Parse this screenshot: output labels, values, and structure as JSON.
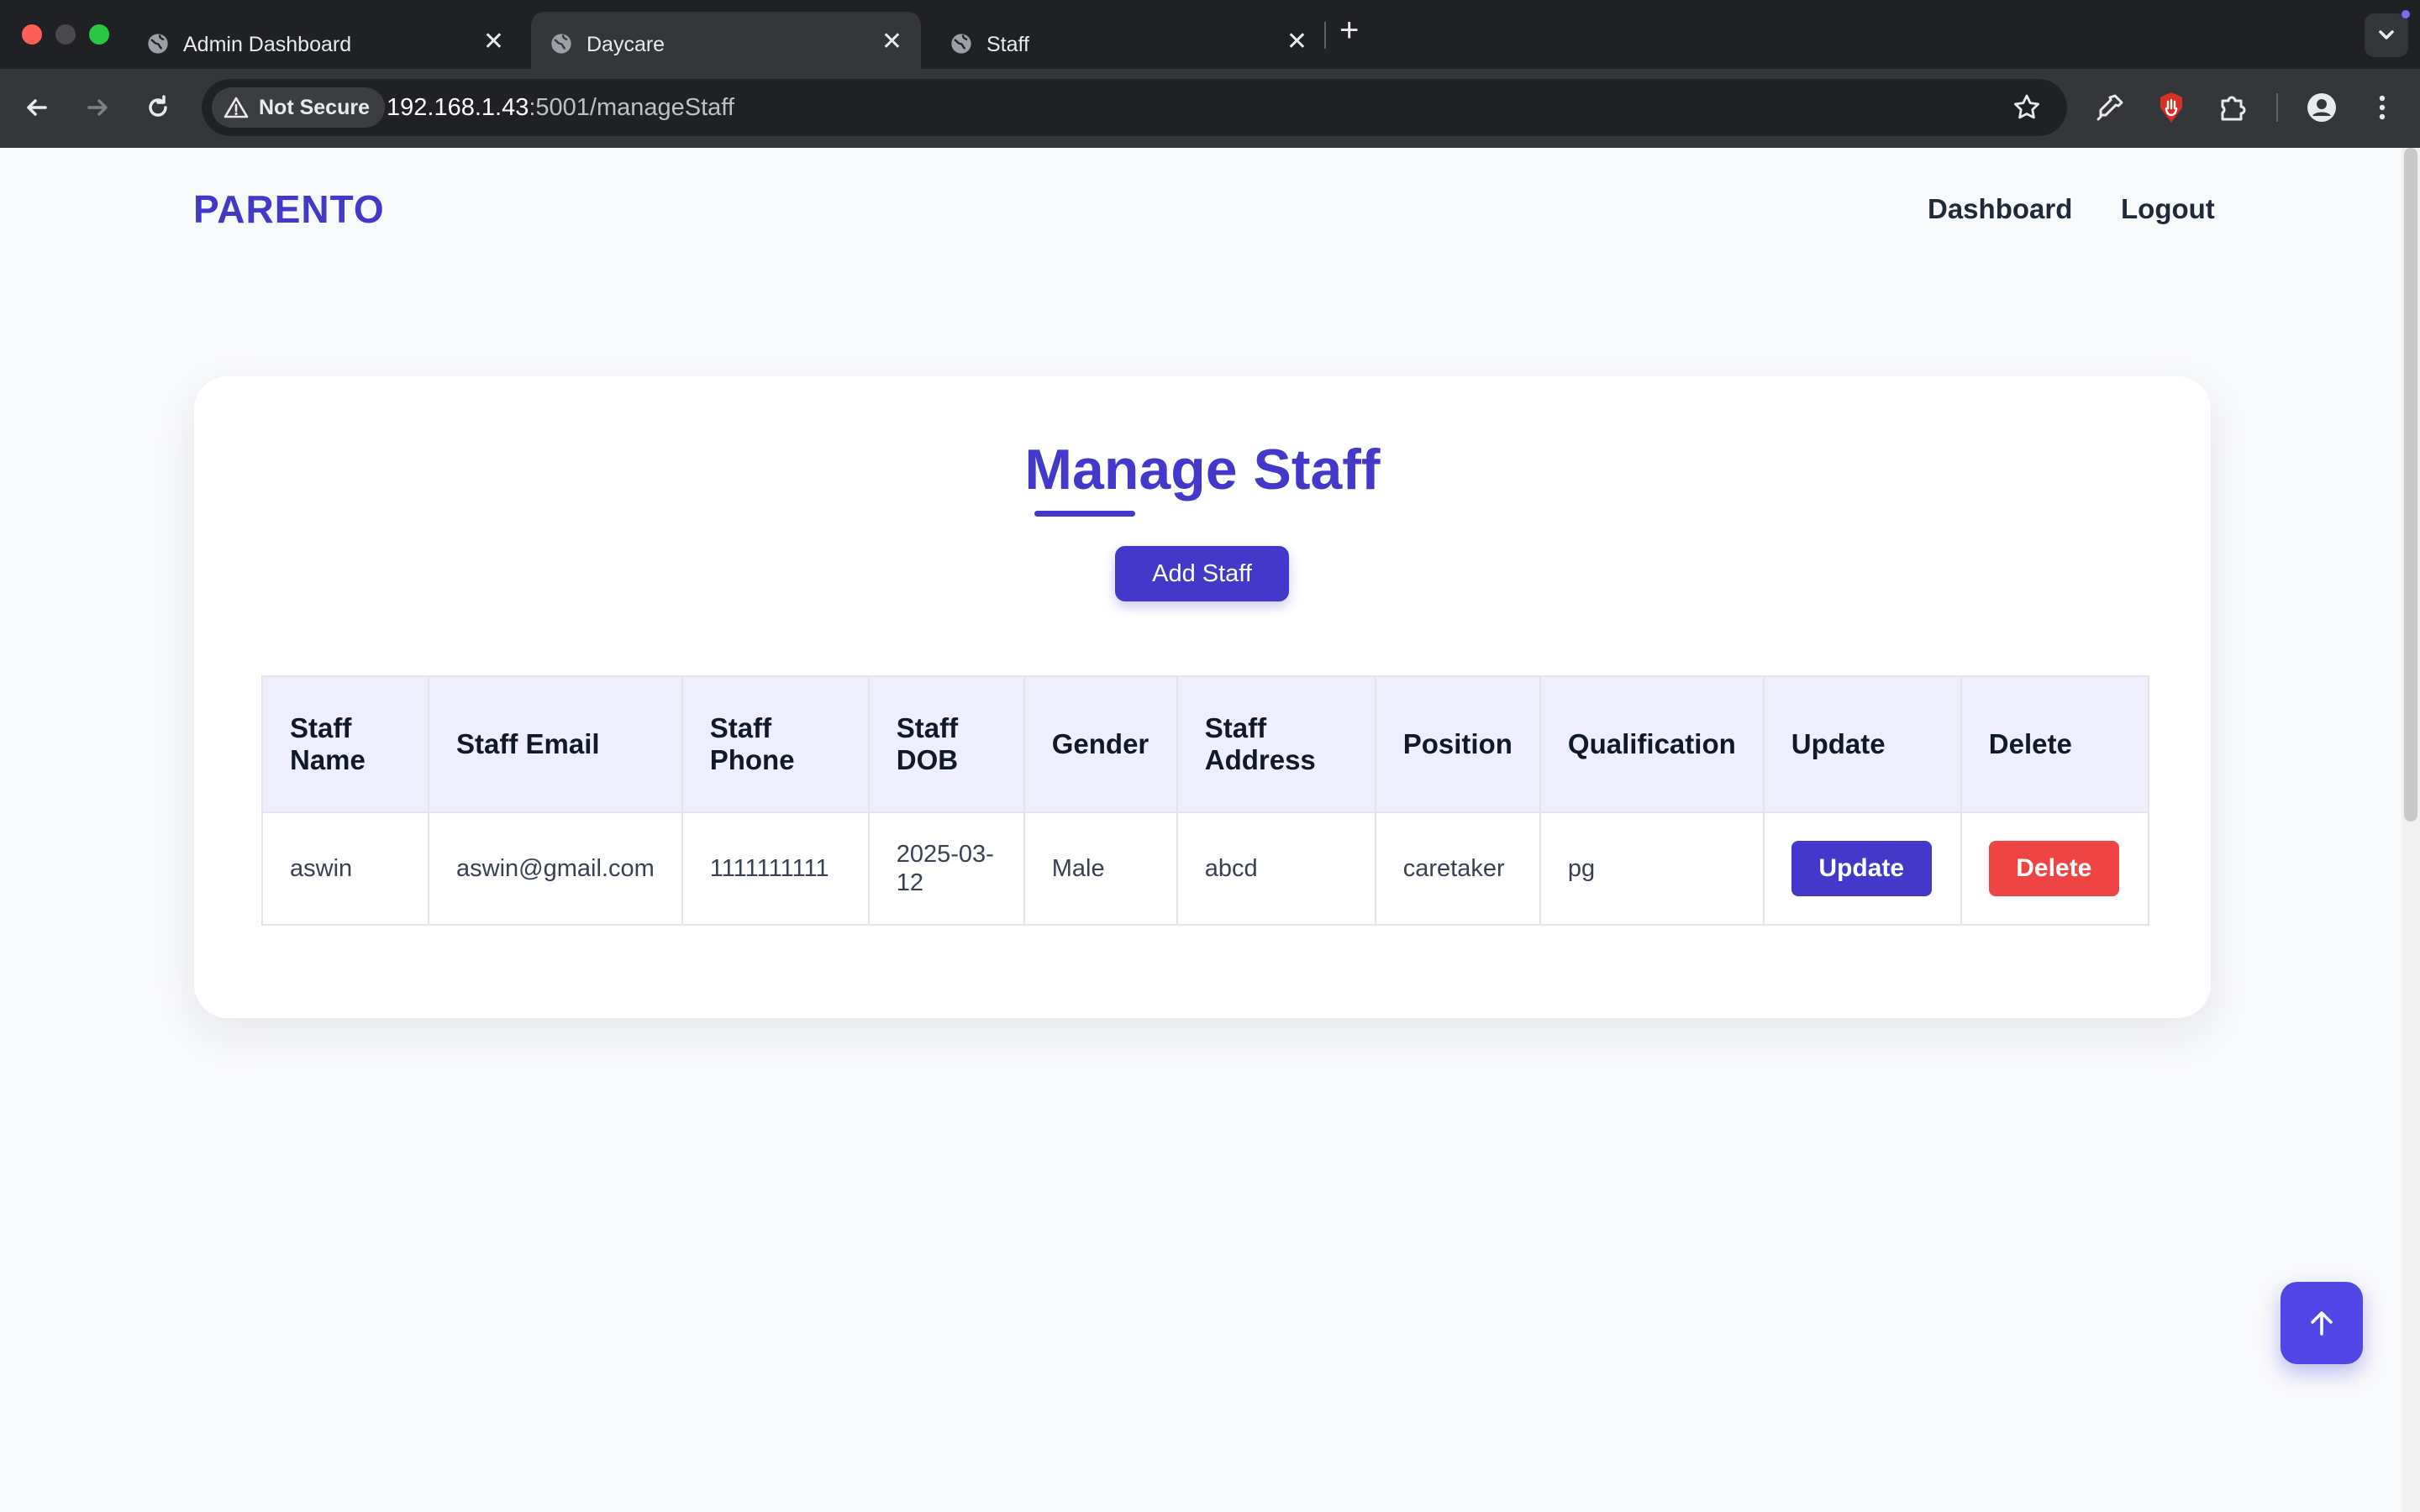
{
  "browser": {
    "tabs": [
      {
        "title": "Admin Dashboard",
        "icon": "globe-icon",
        "active": false
      },
      {
        "title": "Daycare",
        "icon": "globe-icon",
        "active": true
      },
      {
        "title": "Staff",
        "icon": "globe-icon",
        "active": false
      }
    ],
    "close_glyph": "✕",
    "new_tab_glyph": "+",
    "security_label": "Not Secure",
    "url_host": "192.168.1.43",
    "url_path": ":5001/manageStaff"
  },
  "nav": {
    "brand": "PARENTO",
    "links": [
      "Dashboard",
      "Logout"
    ]
  },
  "main": {
    "title": "Manage Staff",
    "add_button": "Add Staff"
  },
  "table": {
    "headers": [
      "Staff Name",
      "Staff Email",
      "Staff Phone",
      "Staff DOB",
      "Gender",
      "Staff Address",
      "Position",
      "Qualification",
      "Update",
      "Delete"
    ],
    "rows": [
      {
        "name": "aswin",
        "email": "aswin@gmail.com",
        "phone": "1111111111",
        "dob": "2025-03-12",
        "gender": "Male",
        "address": "abcd",
        "position": "caretaker",
        "qualification": "pg",
        "update_label": "Update",
        "delete_label": "Delete"
      }
    ]
  },
  "colors": {
    "brand": "#4338ca",
    "delete": "#ef4444",
    "scroll_top": "#4f46e5"
  }
}
